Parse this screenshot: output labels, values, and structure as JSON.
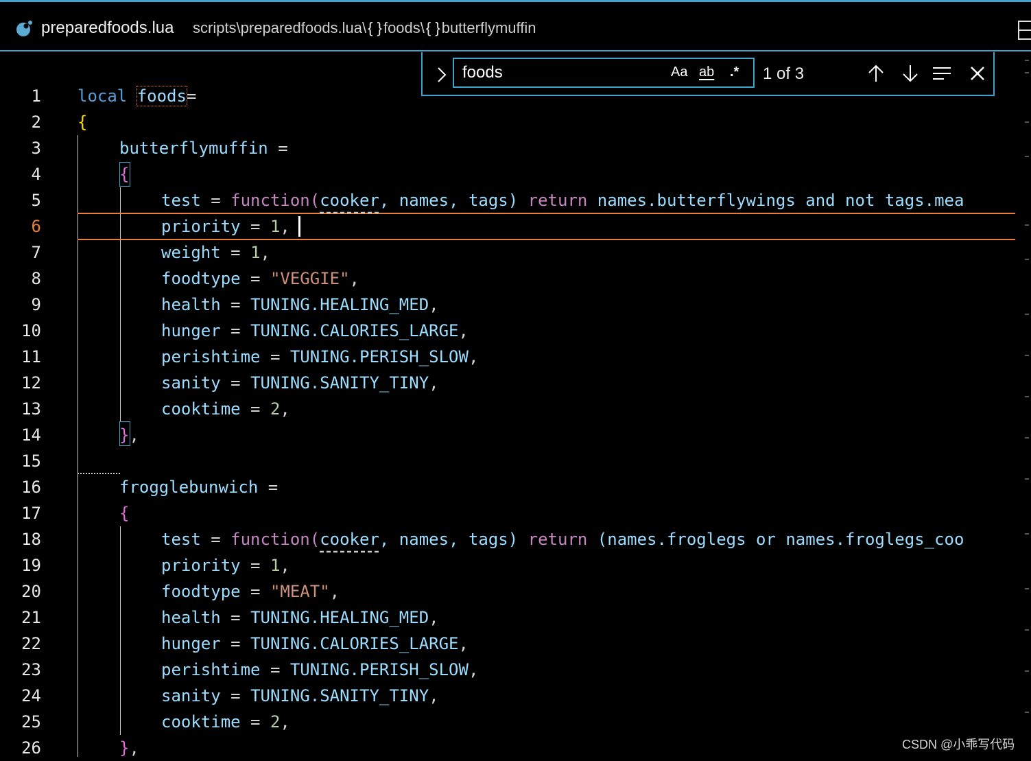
{
  "breadcrumb": {
    "file_name": "preparedfoods.lua",
    "path": "scripts\\preparedfoods.lua\\",
    "symbol1": "foods\\",
    "symbol2": "butterflymuffin",
    "brace_glyph": "{ }"
  },
  "find": {
    "query": "foods",
    "match_case_label": "Aa",
    "whole_word_label": "ab",
    "regex_label": ".*",
    "count": "1 of 3"
  },
  "gutter": {
    "line_numbers": [
      "1",
      "2",
      "3",
      "4",
      "5",
      "6",
      "7",
      "8",
      "9",
      "10",
      "11",
      "12",
      "13",
      "14",
      "15",
      "16",
      "17",
      "18",
      "19",
      "20",
      "21",
      "22",
      "23",
      "24",
      "25",
      "26"
    ],
    "active_line": 6
  },
  "code": {
    "l1": {
      "kw": "local",
      "name": "foods",
      "op": "="
    },
    "l2": {
      "brace": "{"
    },
    "l3": {
      "name": "butterflymuffin",
      "op": " ="
    },
    "l4": {
      "brace": "{"
    },
    "l5": {
      "key": "test",
      "op": " = ",
      "fn": "function(",
      "p1": "cooker",
      "rest": ", names, tags) ",
      "ret": "return",
      "tail": " names.butterflywings and not tags.mea"
    },
    "l6": {
      "key": "priority",
      "op": " = ",
      "num": "1",
      "tail": ","
    },
    "l7": {
      "key": "weight",
      "op": " = ",
      "num": "1",
      "tail": ","
    },
    "l8": {
      "key": "foodtype",
      "op": " = ",
      "str": "\"VEGGIE\"",
      "tail": ","
    },
    "l9": {
      "key": "health",
      "op": " = ",
      "val": "TUNING.HEALING_MED",
      "tail": ","
    },
    "l10": {
      "key": "hunger",
      "op": " = ",
      "val": "TUNING.CALORIES_LARGE",
      "tail": ","
    },
    "l11": {
      "key": "perishtime",
      "op": " = ",
      "val": "TUNING.PERISH_SLOW",
      "tail": ","
    },
    "l12": {
      "key": "sanity",
      "op": " = ",
      "val": "TUNING.SANITY_TINY",
      "tail": ","
    },
    "l13": {
      "key": "cooktime",
      "op": " = ",
      "num": "2",
      "tail": ","
    },
    "l14": {
      "brace": "}",
      "tail": ","
    },
    "l16": {
      "name": "frogglebunwich",
      "op": " ="
    },
    "l17": {
      "brace": "{"
    },
    "l18": {
      "key": "test",
      "op": " = ",
      "fn": "function(",
      "p1": "cooker",
      "rest": ", names, tags) ",
      "ret": "return",
      "tail": " (names.froglegs or names.froglegs_coo"
    },
    "l19": {
      "key": "priority",
      "op": " = ",
      "num": "1",
      "tail": ","
    },
    "l20": {
      "key": "foodtype",
      "op": " = ",
      "str": "\"MEAT\"",
      "tail": ","
    },
    "l21": {
      "key": "health",
      "op": " = ",
      "val": "TUNING.HEALING_MED",
      "tail": ","
    },
    "l22": {
      "key": "hunger",
      "op": " = ",
      "val": "TUNING.CALORIES_LARGE",
      "tail": ","
    },
    "l23": {
      "key": "perishtime",
      "op": " = ",
      "val": "TUNING.PERISH_SLOW",
      "tail": ","
    },
    "l24": {
      "key": "sanity",
      "op": " = ",
      "val": "TUNING.SANITY_TINY",
      "tail": ","
    },
    "l25": {
      "key": "cooktime",
      "op": " = ",
      "num": "2",
      "tail": ","
    },
    "l26": {
      "brace": "}",
      "tail": ","
    }
  },
  "watermark": "CSDN @小乖写代码",
  "colors": {
    "accent": "#3fa3c9",
    "active_line": "#e8803a",
    "keyword": "#569cd6",
    "identifier": "#9cdcfe",
    "function": "#c586c0",
    "string": "#ce9178",
    "number": "#b5cea8"
  },
  "icons": [
    "lua-file-icon",
    "split-editor-icon",
    "find-toggle-chevron-icon",
    "previous-match-icon",
    "next-match-icon",
    "find-in-selection-icon",
    "close-icon"
  ]
}
